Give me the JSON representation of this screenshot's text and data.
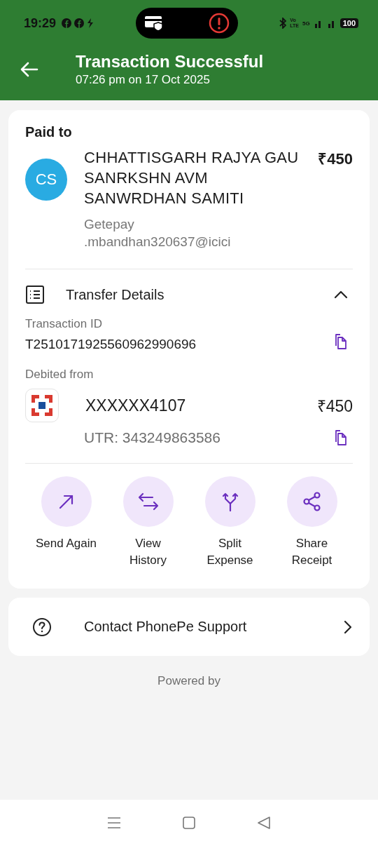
{
  "status_bar": {
    "time": "19:29",
    "network_labels": [
      "Vo",
      "LTE",
      "5G"
    ],
    "battery": "100"
  },
  "header": {
    "title": "Transaction Successful",
    "subtitle": "07:26 pm on 17 Oct 2025"
  },
  "paid_to": {
    "heading": "Paid to",
    "initials": "CS",
    "name": "CHHATTISGARH RAJYA GAU SANRKSHN AVM SANWRDHAN SAMITI",
    "amount": "₹450",
    "upi_id": "Getepay\n.mbandhan320637@icici"
  },
  "transfer_details": {
    "title": "Transfer Details",
    "expanded": true,
    "transaction_id_label": "Transaction ID",
    "transaction_id": "T2510171925560962990696",
    "debited_label": "Debited from",
    "account": "XXXXXX4107",
    "amount": "₹450",
    "utr": "UTR: 343249863586"
  },
  "actions": [
    {
      "kind": "send",
      "label": "Send Again"
    },
    {
      "kind": "history",
      "label": "View\nHistory"
    },
    {
      "kind": "split",
      "label": "Split\nExpense"
    },
    {
      "kind": "share",
      "label": "Share\nReceipt"
    }
  ],
  "support": {
    "label": "Contact PhonePe Support"
  },
  "footer": {
    "powered_by": "Powered by"
  }
}
